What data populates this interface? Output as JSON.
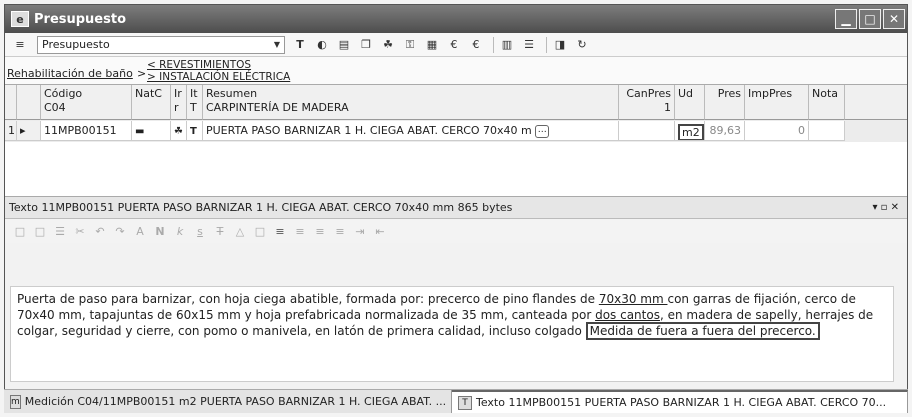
{
  "window": {
    "title": "Presupuesto",
    "app_icon": "e"
  },
  "toolbar": {
    "combo_value": "Presupuesto",
    "icons": [
      "budget-icon",
      "text-t-icon",
      "globe-icon",
      "measure-icon",
      "copy-icon",
      "tree-icon",
      "key-icon",
      "table-icon",
      "euro-icon",
      "euro2-icon",
      "grid-icon",
      "rows-icon",
      "split-icon",
      "redo-icon"
    ]
  },
  "breadcrumb": {
    "crumb": "Rehabilitación de baño",
    "arrow": ">",
    "sub1": "< REVESTIMIENTOS",
    "sub2": "> INSTALACIÓN ELÉCTRICA"
  },
  "grid": {
    "headers": {
      "codigo": "Código",
      "codigo_val": "C04",
      "natc": "NatC",
      "ir": "Ir",
      "ir2": "r",
      "it": "It",
      "it2": "T",
      "resumen": "Resumen",
      "resumen_val": "CARPINTERÍA DE MADERA",
      "canpres": "CanPres",
      "canpres_val": "1",
      "ud": "Ud",
      "pres": "Pres",
      "imppres": "ImpPres",
      "nota": "Nota"
    },
    "row": {
      "num": "1",
      "marker": "▸",
      "codigo": "11MPB00151",
      "resumen": "PUERTA PASO BARNIZAR 1 H. CIEGA ABAT. CERCO 70x40 m",
      "ud": "m2",
      "pres": "89,63",
      "imppres": "0"
    }
  },
  "panel": {
    "title": "Texto 11MPB00151 PUERTA PASO BARNIZAR 1 H. CIEGA ABAT. CERCO 70x40 mm 865 bytes",
    "controls": "▾  ▫  ✕"
  },
  "text": {
    "p1": "Puerta de paso para barnizar, con hoja ciega abatible, formada por: precerco de pino flandes de ",
    "u1": "70x30 mm ",
    "p2": "con garras de fijación, cerco de 70x40 mm, tapajuntas de 60x15 mm y hoja prefabricada normalizada de 35 mm, canteada por ",
    "u2": "dos cantos",
    "p3": ", en madera de sapelly, herrajes de colgar, seguridad y cierre, con pomo o manivela, en latón de primera calidad, incluso colgado ",
    "boxed": "Medida de fuera a fuera del precerco."
  },
  "tabs": [
    {
      "icon": "m",
      "label": "Medición C04/11MPB00151 m2 PUERTA PASO BARNIZAR 1 H. CIEGA ABAT. ..."
    },
    {
      "icon": "T",
      "label": "Texto 11MPB00151 PUERTA PASO BARNIZAR 1 H. CIEGA ABAT. CERCO 70..."
    }
  ]
}
